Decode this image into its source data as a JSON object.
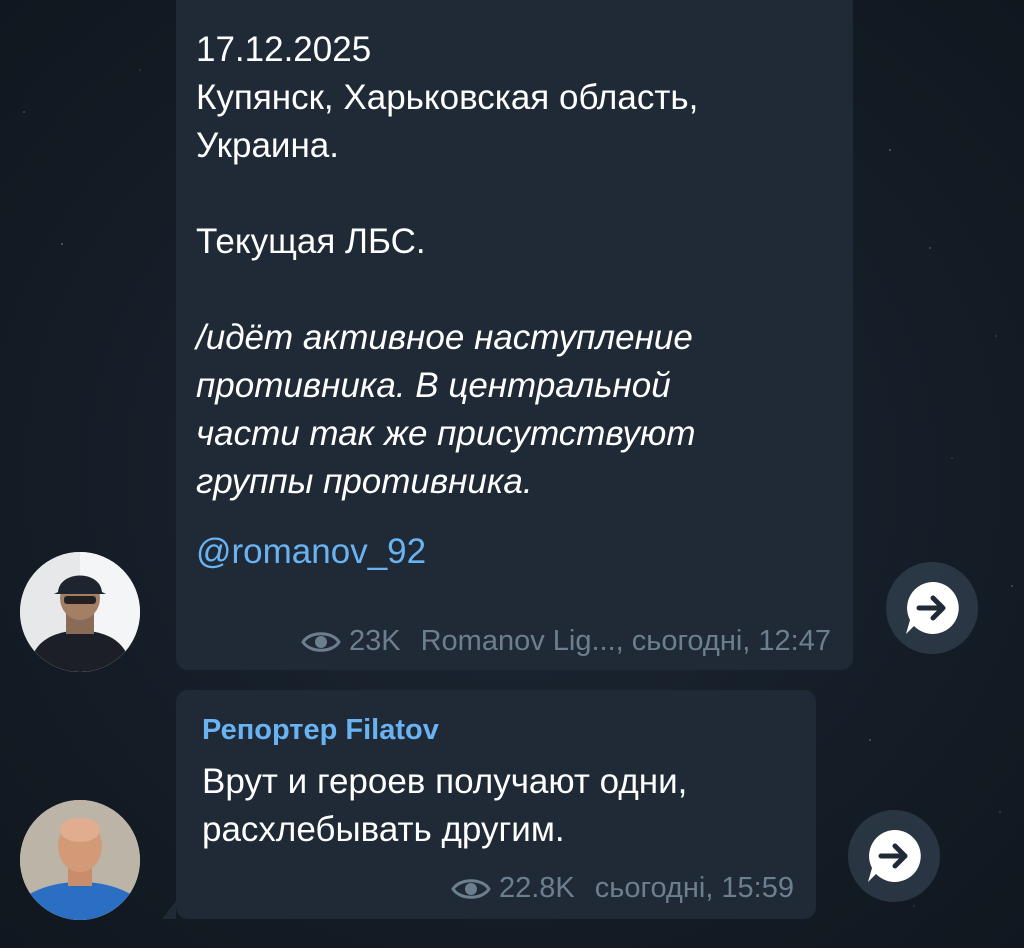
{
  "messages": [
    {
      "date_line": "17.12.2025",
      "location_line": "Купянск, Харьковская область,\nУкраина.",
      "status_line": "Текущая ЛБС.",
      "italic_text": "/идёт активное наступление\nпротивника. В центральной\nчасти так же присутствуют\nгруппы противника.",
      "link": "@romanov_92",
      "views": "23K",
      "author": "Romanov Lig...",
      "time": ", сьогодні, 12:47",
      "icons": {
        "views": "eye-icon",
        "forward": "forward-arrow-icon"
      }
    },
    {
      "sender": "Репортер Filatov",
      "text": "Врут и героев получают одни,\nрасхлебывать другим.",
      "views": "22.8K",
      "time": "сьогодні, 15:59",
      "icons": {
        "views": "eye-icon",
        "forward": "forward-arrow-icon"
      }
    }
  ],
  "colors": {
    "bubble": "#1f2a36",
    "link": "#6ab3f3",
    "meta": "#6d7f8f",
    "background": "#131b24"
  }
}
